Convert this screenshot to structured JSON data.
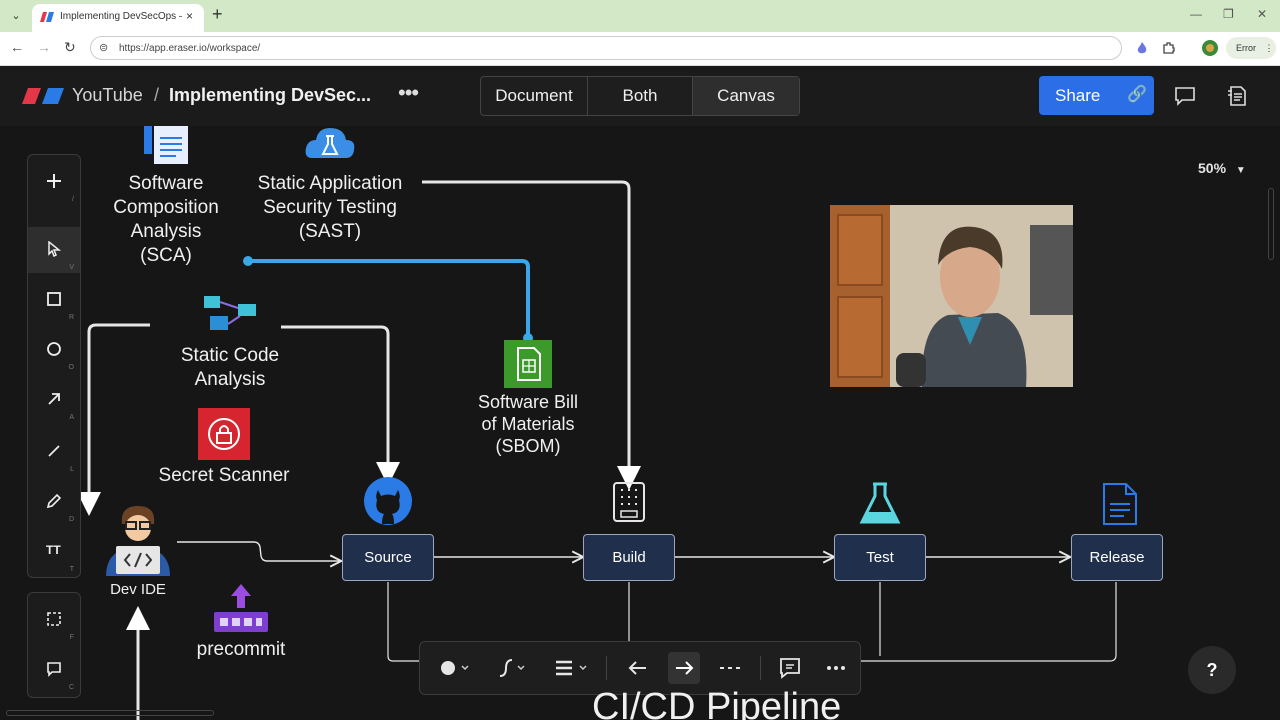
{
  "browser": {
    "tab_title": "Implementing DevSecOps — E",
    "tab_close": "×",
    "new_tab": "+",
    "url": "https://app.eraser.io/workspace/",
    "error_label": "Error"
  },
  "header": {
    "app_name": "YouTube",
    "separator": "/",
    "doc_title": "Implementing DevSec...",
    "view_toggle": [
      "Document",
      "Both",
      "Canvas"
    ],
    "active_view": "Canvas",
    "share_label": "Share"
  },
  "toolbar": {
    "tools": [
      {
        "name": "add",
        "key": "/"
      },
      {
        "name": "select",
        "key": "V"
      },
      {
        "name": "rectangle",
        "key": "R"
      },
      {
        "name": "ellipse",
        "key": "O"
      },
      {
        "name": "arrow",
        "key": "A"
      },
      {
        "name": "line",
        "key": "L"
      },
      {
        "name": "pencil",
        "key": "D"
      },
      {
        "name": "text",
        "key": "T",
        "glyph": "TT"
      },
      {
        "name": "frame",
        "key": "F"
      },
      {
        "name": "comment",
        "key": "C"
      }
    ]
  },
  "canvas": {
    "zoom": "50%",
    "labels": {
      "sca": [
        "Software",
        "Composition",
        "Analysis",
        "(SCA)"
      ],
      "sast": [
        "Static Application",
        "Security Testing",
        "(SAST)"
      ],
      "static_code": [
        "Static Code",
        "Analysis"
      ],
      "secret_scanner": "Secret Scanner",
      "sbom": [
        "Software Bill",
        "of Materials",
        "(SBOM)"
      ],
      "dev_ide": "Dev IDE",
      "precommit": "precommit",
      "pipeline_title": "CI/CD Pipeline"
    },
    "nodes": {
      "source": "Source",
      "build": "Build",
      "test": "Test",
      "release": "Release"
    },
    "help": "?"
  },
  "colors": {
    "accent": "#2b6ee6",
    "selected_connector": "#3aa8e8",
    "node_fill": "#1f2f4c",
    "tabbar": "#d3e8c6"
  }
}
